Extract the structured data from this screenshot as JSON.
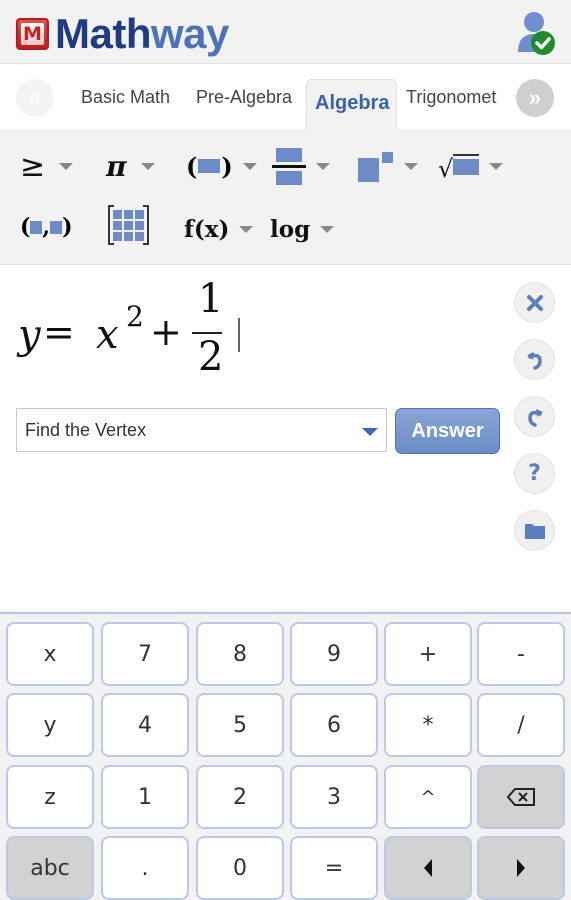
{
  "header": {
    "logo_mark": "M",
    "logo_text_part1": "Math",
    "logo_text_part2": "way",
    "user_icon": "user-verified-icon"
  },
  "tabs": {
    "prev_icon": "«",
    "next_icon": "»",
    "items": [
      {
        "label": "Basic Math",
        "active": false
      },
      {
        "label": "Pre-Algebra",
        "active": false
      },
      {
        "label": "Algebra",
        "active": true
      },
      {
        "label": "Trigonomet",
        "active": false
      }
    ]
  },
  "toolbar": {
    "row1": [
      {
        "name": "inequality-icon",
        "glyph": "≥",
        "dropdown": true
      },
      {
        "name": "pi-icon",
        "glyph": "π",
        "dropdown": true
      },
      {
        "name": "parentheses-icon",
        "glyph": "( )",
        "dropdown": true
      },
      {
        "name": "fraction-icon",
        "glyph": "fraction",
        "dropdown": true
      },
      {
        "name": "exponent-icon",
        "glyph": "power",
        "dropdown": true
      },
      {
        "name": "sqrt-icon",
        "glyph": "√",
        "dropdown": true
      }
    ],
    "row2": [
      {
        "name": "ordered-pair-icon",
        "glyph": "(,)",
        "dropdown": false
      },
      {
        "name": "matrix-icon",
        "glyph": "matrix",
        "dropdown": false
      },
      {
        "name": "function-icon",
        "glyph": "f(x)",
        "dropdown": true
      },
      {
        "name": "log-icon",
        "glyph": "log",
        "dropdown": true
      }
    ]
  },
  "editor": {
    "expression": "y = x^2 + 1/2",
    "tokens": {
      "y": "y",
      "eq": "=",
      "x": "x",
      "exp": "2",
      "plus": "+",
      "num": "1",
      "den": "2"
    },
    "topic_select": {
      "value": "Find the Vertex"
    },
    "answer_label": "Answer",
    "side_buttons": [
      "clear-icon",
      "undo-icon",
      "redo-icon",
      "help-icon",
      "folder-icon"
    ]
  },
  "keypad": {
    "rows": [
      [
        {
          "label": "x"
        },
        {
          "label": "7"
        },
        {
          "label": "8"
        },
        {
          "label": "9"
        },
        {
          "label": "+"
        },
        {
          "label": "-"
        }
      ],
      [
        {
          "label": "y"
        },
        {
          "label": "4"
        },
        {
          "label": "5"
        },
        {
          "label": "6"
        },
        {
          "label": "*"
        },
        {
          "label": "/"
        }
      ],
      [
        {
          "label": "z"
        },
        {
          "label": "1"
        },
        {
          "label": "2"
        },
        {
          "label": "3"
        },
        {
          "label": "^"
        },
        {
          "label": "",
          "icon": "backspace-icon"
        }
      ],
      [
        {
          "label": "abc"
        },
        {
          "label": "."
        },
        {
          "label": "0"
        },
        {
          "label": "="
        },
        {
          "label": "",
          "icon": "cursor-left-icon"
        },
        {
          "label": "",
          "icon": "cursor-right-icon"
        }
      ]
    ]
  },
  "colors": {
    "brand_dark": "#1e3b84",
    "brand_light": "#4d72b8",
    "accent": "#6c8bc7",
    "verified": "#1f8a2e"
  }
}
